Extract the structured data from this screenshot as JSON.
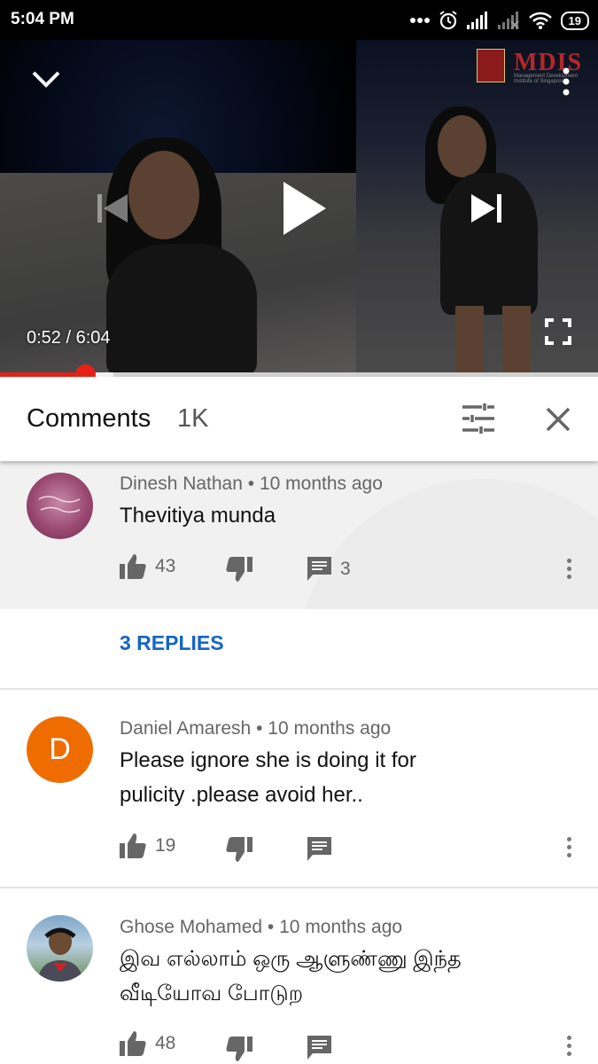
{
  "status_bar": {
    "time": "5:04 PM",
    "battery": "19"
  },
  "player": {
    "time_current": "0:52",
    "time_separator": " / ",
    "time_total": "6:04",
    "progress_played_fraction": 0.142,
    "progress_buffered_fraction": 0.19,
    "logo_text": "MDIS",
    "logo_subtext": "Management Development Institute of Singapore"
  },
  "comments_header": {
    "title": "Comments",
    "count": "1K"
  },
  "comments": [
    {
      "author": "Dinesh Nathan",
      "age": "10 months ago",
      "text": "Thevitiya munda",
      "likes": "43",
      "replies": "3"
    },
    {
      "author": "Daniel Amaresh",
      "age": "10 months ago",
      "text_lines": [
        "Please  ignore  she is doing  it for",
        "pulicity  .please  avoid her.."
      ],
      "likes": "19",
      "avatar_letter": "D"
    },
    {
      "author": "Ghose Mohamed",
      "age": "10 months ago",
      "text_lines": [
        "இவ எல்லாம் ஒரு ஆளுண்ணு இந்த",
        "வீடியோவ போடுற"
      ],
      "likes": "48"
    }
  ],
  "replies_link": "3 REPLIES",
  "meta_separator": " • ",
  "colors": {
    "accent_red": "#e52117",
    "link_blue": "#1565c0",
    "avatar_orange": "#ef6c00"
  }
}
